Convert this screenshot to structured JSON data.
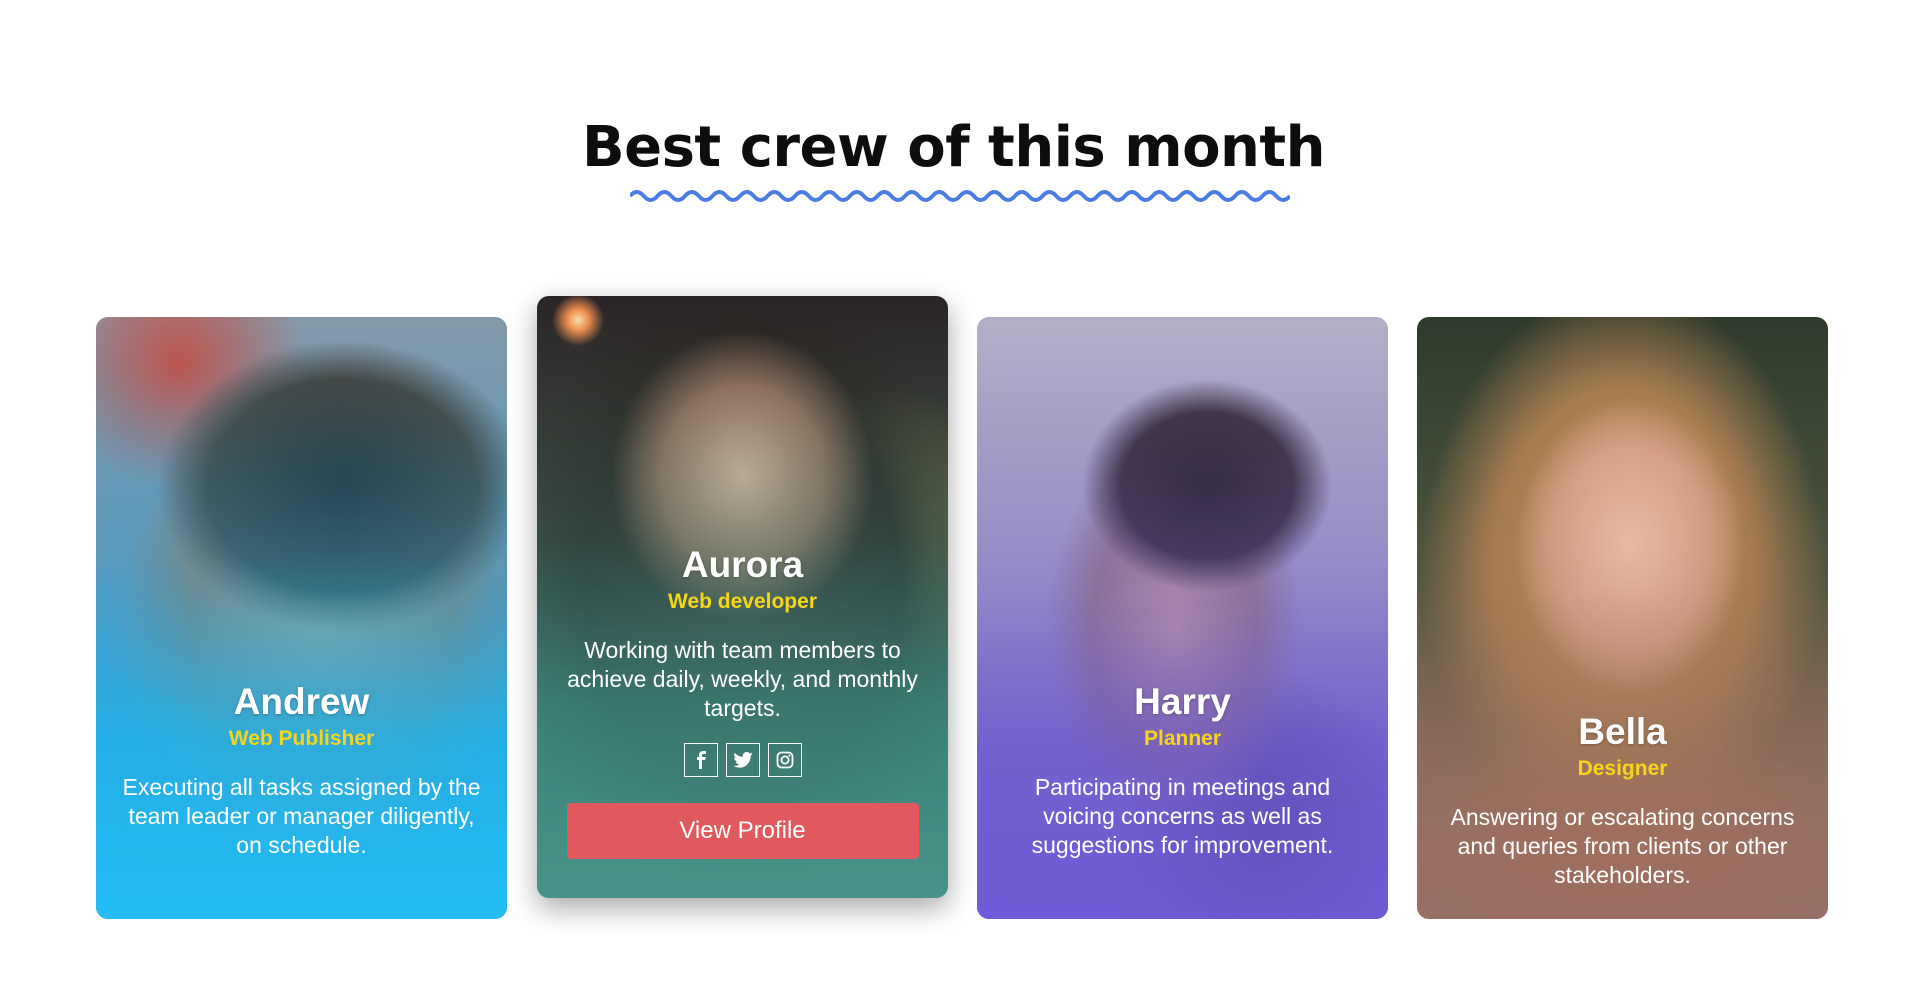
{
  "section": {
    "title": "Best crew of this month"
  },
  "colors": {
    "accent_wave": "#4a7de2",
    "role_yellow": "#f6d51b",
    "button_red": "#e05a5d"
  },
  "cards": [
    {
      "name": "Andrew",
      "role": "Web Publisher",
      "description": "Executing all tasks assigned by the team leader or manager diligently, on schedule.",
      "photo": "man-with-sunglasses-photo",
      "tint": "#1ab6f0"
    },
    {
      "name": "Aurora",
      "role": "Web developer",
      "description": "Working with team members to achieve daily, weekly, and monthly targets.",
      "photo": "woman-drinking-photo",
      "tint": "#3d8f86",
      "social": [
        "facebook-icon",
        "twitter-icon",
        "instagram-icon"
      ],
      "button_label": "View Profile"
    },
    {
      "name": "Harry",
      "role": "Planner",
      "description": "Participating in meetings and voicing concerns as well as suggestions for improvement.",
      "photo": "man-profile-photo",
      "tint": "#6b55d0"
    },
    {
      "name": "Bella",
      "role": "Designer",
      "description": "Answering or escalating concerns and queries from clients or other stakeholders.",
      "photo": "smiling-woman-photo",
      "tint": "#9a6f62"
    }
  ]
}
